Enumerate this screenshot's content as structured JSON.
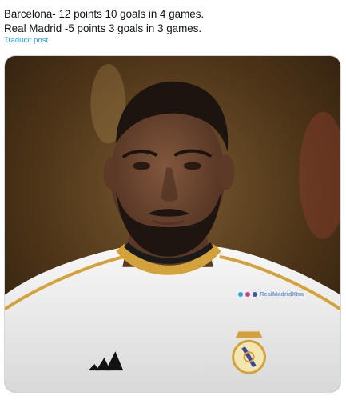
{
  "tweet": {
    "lines": [
      "Barcelona- 12 points 10 goals in 4 games.",
      "Real Madrid -5 points 3 goals in 3 games."
    ],
    "translate_label": "Traducir post"
  },
  "media": {
    "watermark_text": "RealMadridXtra",
    "colors": {
      "background_warm": "#5a3f20",
      "jersey": "#f2f2f2",
      "collar_gold": "#d4a23a",
      "collar_black": "#1a1a1a",
      "skin": "#6b4632"
    }
  }
}
